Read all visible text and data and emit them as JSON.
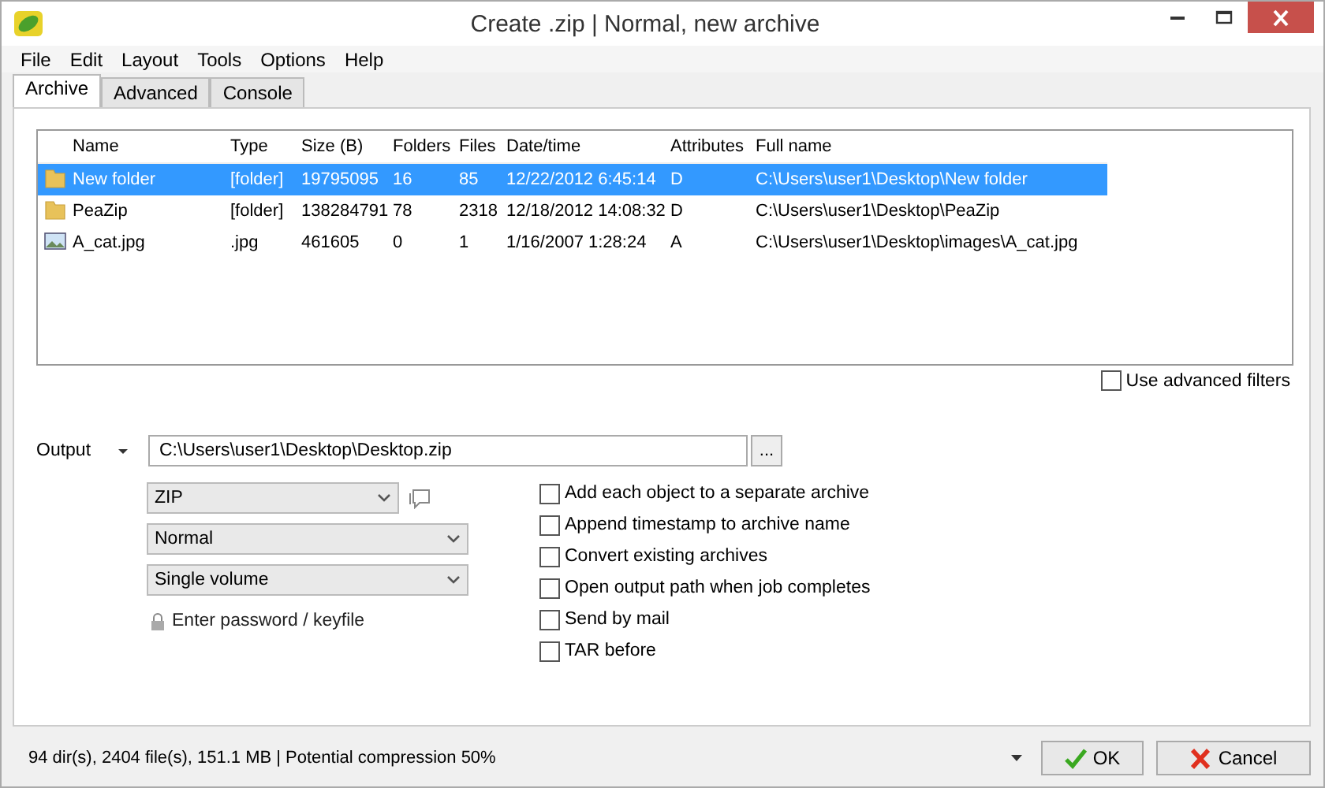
{
  "window": {
    "title": "Create .zip | Normal, new archive"
  },
  "menu": [
    "File",
    "Edit",
    "Layout",
    "Tools",
    "Options",
    "Help"
  ],
  "tabs": [
    {
      "label": "Archive",
      "selected": true
    },
    {
      "label": "Advanced",
      "selected": false
    },
    {
      "label": "Console",
      "selected": false
    }
  ],
  "file_list": {
    "columns": [
      "Name",
      "Type",
      "Size (B)",
      "Folders",
      "Files",
      "Date/time",
      "Attributes",
      "Full name"
    ],
    "rows": [
      {
        "kind": "folder",
        "selected": true,
        "cells": [
          "New folder",
          "[folder]",
          "19795095",
          "16",
          "85",
          "12/22/2012 6:45:14",
          "D",
          "C:\\Users\\user1\\Desktop\\New folder"
        ]
      },
      {
        "kind": "folder",
        "selected": false,
        "cells": [
          "PeaZip",
          "[folder]",
          "138284791",
          "78",
          "2318",
          "12/18/2012 14:08:32",
          "D",
          "C:\\Users\\user1\\Desktop\\PeaZip"
        ]
      },
      {
        "kind": "image",
        "selected": false,
        "cells": [
          "A_cat.jpg",
          ".jpg",
          "461605",
          "0",
          "1",
          "1/16/2007 1:28:24",
          "A",
          "C:\\Users\\user1\\Desktop\\images\\A_cat.jpg"
        ]
      }
    ]
  },
  "advanced_filters": {
    "label": "Use advanced filters",
    "checked": false
  },
  "output": {
    "label": "Output",
    "path": "C:\\Users\\user1\\Desktop\\Desktop.zip",
    "browse": "..."
  },
  "format": {
    "value": "ZIP"
  },
  "compression_level": {
    "value": "Normal"
  },
  "volume": {
    "value": "Single volume"
  },
  "password": {
    "label": "Enter password / keyfile"
  },
  "options": [
    {
      "label": "Add each object to a separate archive",
      "checked": false
    },
    {
      "label": "Append timestamp to archive name",
      "checked": false
    },
    {
      "label": "Convert existing archives",
      "checked": false
    },
    {
      "label": "Open output path when job completes",
      "checked": false
    },
    {
      "label": "Send by mail",
      "checked": false
    },
    {
      "label": "TAR before",
      "checked": false
    }
  ],
  "status_bar": {
    "text": "94 dir(s), 2404 file(s), 151.1 MB | Potential compression 50%"
  },
  "buttons": [
    {
      "kind": "ok",
      "label": "OK"
    },
    {
      "kind": "cancel",
      "label": "Cancel"
    }
  ]
}
